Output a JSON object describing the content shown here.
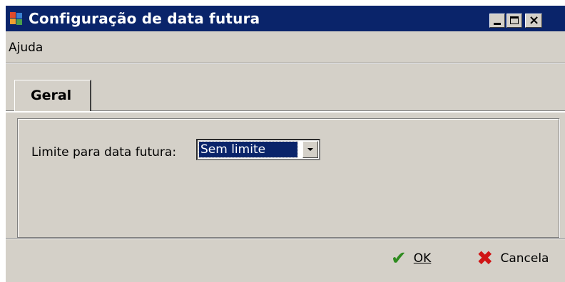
{
  "window": {
    "title": "Configuração de data futura",
    "controls": {
      "minimize": "_",
      "maximize": "☐",
      "close": "×"
    }
  },
  "menu": {
    "items": [
      {
        "label": "Ajuda"
      }
    ]
  },
  "tabs": [
    {
      "label": "Geral",
      "active": true
    }
  ],
  "form": {
    "limit_label": "Limite para data futura:",
    "limit_value": "Sem limite"
  },
  "buttons": {
    "ok": {
      "label": "OK",
      "icon": "check-icon",
      "color": "#2e8b1f"
    },
    "cancel": {
      "label": "Cancela",
      "icon": "x-icon",
      "color": "#d01515"
    }
  },
  "colors": {
    "titlebar": "#0a246a",
    "face": "#d4d0c8",
    "selection": "#0a246a"
  }
}
